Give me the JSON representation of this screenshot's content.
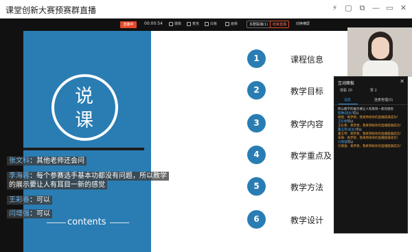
{
  "window": {
    "title": "课堂创新大赛预赛群直播",
    "controls": [
      "⚡",
      "▢",
      "⧉",
      "—",
      "▭",
      "✕"
    ]
  },
  "toolbar": {
    "live": "直播中",
    "time": "00:00:54",
    "items": [
      "摄像",
      "麦克",
      "白板",
      "画板"
    ],
    "box1": "多群联播(1)",
    "box2": "结束直播",
    "box3": "切换横屏"
  },
  "slide": {
    "char1": "说",
    "char2": "课",
    "contents": "contents",
    "agenda": [
      {
        "num": "1",
        "label": "课程信息"
      },
      {
        "num": "2",
        "label": "教学目标"
      },
      {
        "num": "3",
        "label": "教学内容"
      },
      {
        "num": "4",
        "label": "教学重点及"
      },
      {
        "num": "5",
        "label": "教学方法"
      },
      {
        "num": "6",
        "label": "教学设计"
      }
    ]
  },
  "comments": [
    {
      "name": "张文科",
      "text": "：其他老师还会问"
    },
    {
      "name": "李海蓉",
      "text": "：每个参赛选手基本功都没有问题，所以教学"
    },
    {
      "name": "",
      "text": "的展示要让人有耳目一新的感觉"
    },
    {
      "name": "王彩春",
      "text": "：可以"
    },
    {
      "name": "闫增强",
      "text": "：可以"
    }
  ],
  "panel": {
    "title": "互动面板",
    "close": "✕",
    "viewers": "观看 20",
    "likes": "赞 2",
    "tab_active": "消息",
    "tab_other": "连麦管理(0)",
    "messages": [
      {
        "name": "",
        "text": "所以教学的展示要让人有耳目一新的感觉",
        "orange": ""
      },
      {
        "name": "程琳(班长)",
        "text": "可以",
        "orange": ""
      },
      {
        "name": "",
        "text": "",
        "orange": "胡铭：真梦想，我来预祝你的直播圆满成功！"
      },
      {
        "name": "王彩春",
        "text": "可以",
        "orange": ""
      },
      {
        "name": "",
        "text": "",
        "orange": "王彩春：真梦想，我来预祝你的直播圆满成功！"
      },
      {
        "name": "董玉琴(班主)",
        "text": "可以",
        "orange": ""
      },
      {
        "name": "",
        "text": "",
        "orange": "董玉琴：真梦想，我来预祝你的直播圆满成功！"
      },
      {
        "name": "",
        "text": "",
        "orange": "朱琳：真梦想，我来预祝你的直播圆满成功！"
      },
      {
        "name": "闫增强",
        "text": "可以",
        "orange": ""
      },
      {
        "name": "",
        "text": "",
        "orange": "闫增强：真梦想，我来预祝你的直播圆满成功！"
      }
    ]
  }
}
